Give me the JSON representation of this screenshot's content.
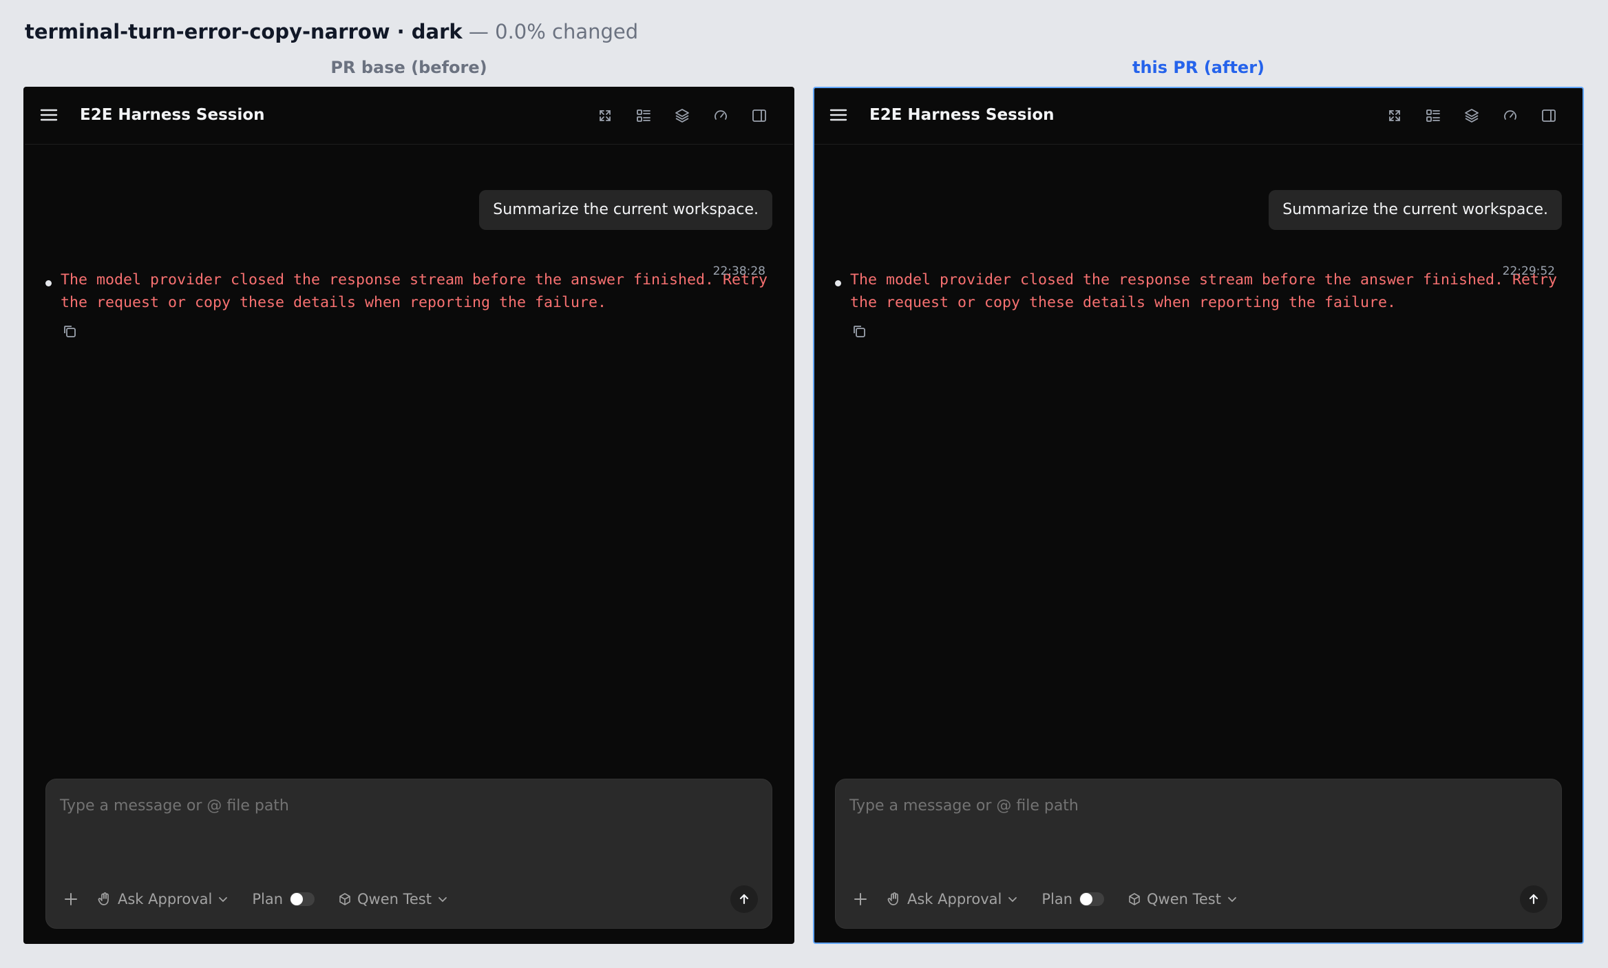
{
  "header": {
    "test_name": "terminal-turn-error-copy-narrow · dark",
    "separator": " — ",
    "changed": "0.0% changed"
  },
  "columns": [
    {
      "label": "PR base (before)",
      "session_title": "E2E Harness Session",
      "user_message": "Summarize the current workspace.",
      "timestamp": "22:38:28",
      "error_text": "The model provider closed the response stream before the answer finished. Retry the request or copy these details when reporting the failure.",
      "composer_placeholder": "Type a message or @ file path",
      "approval_label": "Ask Approval",
      "plan_label": "Plan",
      "plan_enabled": false,
      "model_label": "Qwen Test"
    },
    {
      "label": "this PR (after)",
      "session_title": "E2E Harness Session",
      "user_message": "Summarize the current workspace.",
      "timestamp": "22:29:52",
      "error_text": "The model provider closed the response stream before the answer finished. Retry the request or copy these details when reporting the failure.",
      "composer_placeholder": "Type a message or @ file path",
      "approval_label": "Ask Approval",
      "plan_label": "Plan",
      "plan_enabled": false,
      "model_label": "Qwen Test"
    }
  ],
  "icons": {
    "menu": "hamburger-menu-icon",
    "toolbar": [
      "expand-icon",
      "checklist-icon",
      "layers-icon",
      "gauge-icon",
      "sidebar-panel-icon"
    ],
    "copy": "copy-icon",
    "add": "plus-icon",
    "approval": "hand-icon",
    "model": "cube-icon",
    "send": "arrow-up-icon"
  },
  "colors": {
    "page_bg": "#e5e7eb",
    "panel_bg": "#0a0a0a",
    "error_text": "#f87171",
    "after_accent": "#2563eb",
    "after_border": "#60a5fa",
    "composer_bg": "#2a2a2a"
  }
}
